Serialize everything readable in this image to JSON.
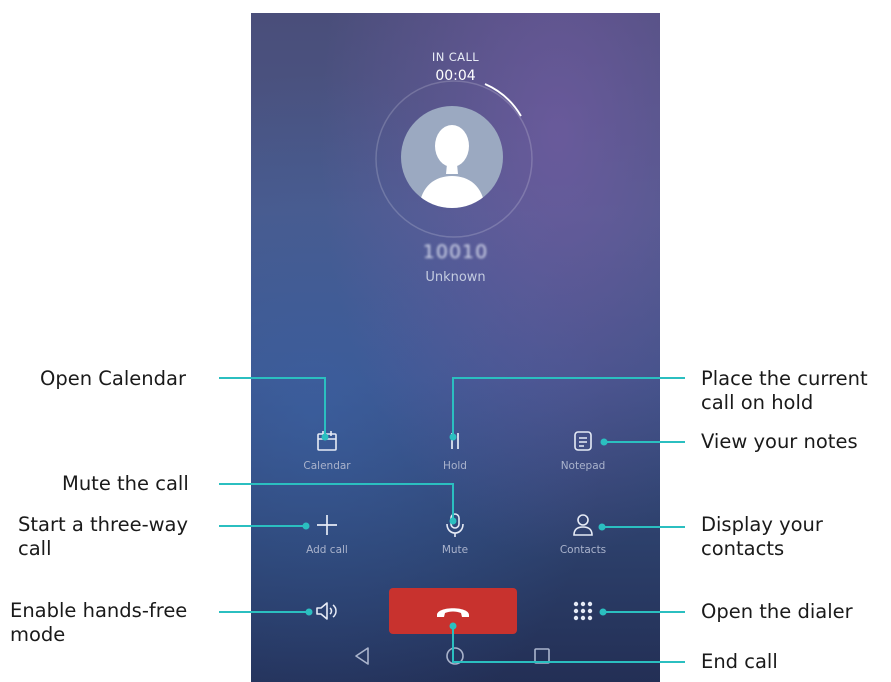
{
  "call_screen": {
    "status": "IN CALL",
    "timer": "00:04",
    "number": "10010",
    "caller_label": "Unknown",
    "buttons": {
      "calendar": "Calendar",
      "hold": "Hold",
      "notepad": "Notepad",
      "add_call": "Add call",
      "mute": "Mute",
      "contacts": "Contacts"
    },
    "icons": [
      "calendar-icon",
      "pause-icon",
      "notepad-icon",
      "plus-icon",
      "microphone-icon",
      "person-icon",
      "speaker-icon",
      "end-call-icon",
      "dialpad-icon",
      "back-icon",
      "home-icon",
      "recents-icon"
    ]
  },
  "callouts": {
    "open_calendar": "Open Calendar",
    "hold_line1": "Place the current",
    "hold_line2": "call on hold",
    "notes": "View your notes",
    "mute": "Mute the call",
    "three_way_line1": "Start a three-way",
    "three_way_line2": "call",
    "contacts_line1": "Display your",
    "contacts_line2": "contacts",
    "handsfree_line1": "Enable hands-free",
    "handsfree_line2": "mode",
    "dialer": "Open the dialer",
    "end_call": "End call"
  },
  "colors": {
    "leader": "#2bbfc0",
    "end_call": "#c8322e"
  }
}
